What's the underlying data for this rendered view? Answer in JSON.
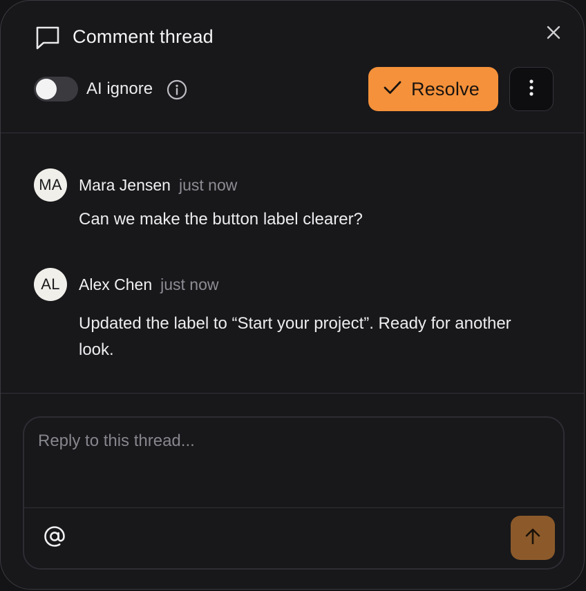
{
  "header": {
    "title": "Comment thread",
    "title_icon": "chat-bubble-icon",
    "close_icon": "close-icon"
  },
  "controls": {
    "ai_ignore_label": "AI ignore",
    "ai_ignore_on": false,
    "info_icon": "info-icon",
    "resolve_label": "Resolve",
    "resolve_icon": "check-icon",
    "more_icon": "more-vertical-icon"
  },
  "comments": [
    {
      "initials": "MA",
      "author": "Mara Jensen",
      "time": "just now",
      "text": "Can we make the button label clearer?"
    },
    {
      "initials": "AL",
      "author": "Alex Chen",
      "time": "just now",
      "text": "Updated the label to “Start your project”. Ready for another look."
    }
  ],
  "composer": {
    "placeholder": "Reply to this thread...",
    "value": "",
    "mention_icon": "at-sign-icon",
    "send_icon": "arrow-up-icon"
  },
  "colors": {
    "accent": "#f5913a",
    "send_disabled": "#8c5a2a",
    "panel_bg": "#18181b"
  }
}
